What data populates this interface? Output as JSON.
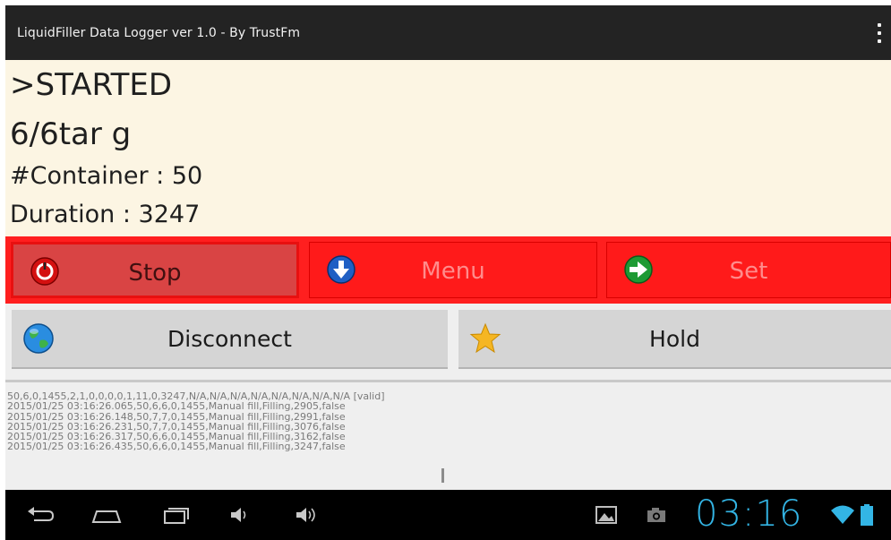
{
  "app": {
    "title": "LiquidFiller Data Logger ver 1.0 - By TrustFm"
  },
  "status": {
    "state": ">STARTED",
    "weight": "6/6tar g",
    "container": "#Container : 50",
    "duration": "Duration : 3247"
  },
  "controls": {
    "stop_label": "Stop",
    "menu_label": "Menu",
    "set_label": "Set",
    "disconnect_label": "Disconnect",
    "hold_label": "Hold"
  },
  "log": {
    "lines": [
      "50,6,0,1455,2,1,0,0,0,0,1,11,0,3247,N/A,N/A,N/A,N/A,N/A,N/A,N/A,N/A [valid]",
      "2015/01/25 03:16:26.065,50,6,6,0,1455,Manual fill,Filling,2905,false",
      "2015/01/25 03:16:26.148,50,7,7,0,1455,Manual fill,Filling,2991,false",
      "2015/01/25 03:16:26.231,50,7,7,0,1455,Manual fill,Filling,3076,false",
      "2015/01/25 03:16:26.317,50,6,6,0,1455,Manual fill,Filling,3162,false",
      "2015/01/25 03:16:26.435,50,6,6,0,1455,Manual fill,Filling,3247,false"
    ]
  },
  "system": {
    "clock": "03:16"
  },
  "colors": {
    "accent": "#33b5e5",
    "danger": "#ff1f1f",
    "panel": "#fcf5e3"
  }
}
